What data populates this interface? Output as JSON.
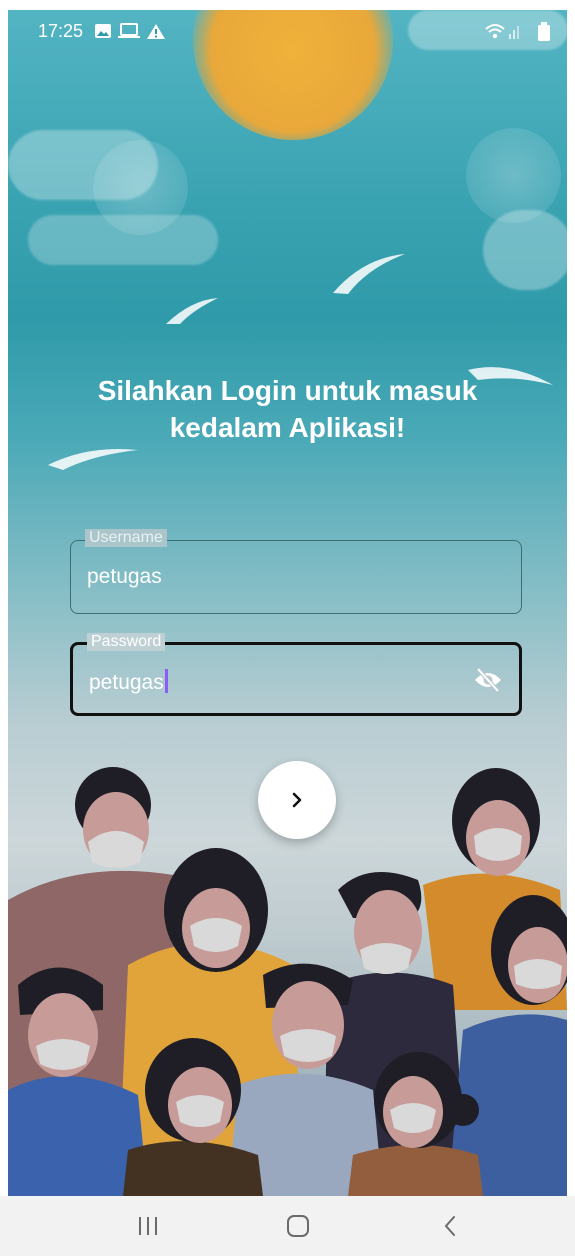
{
  "status_bar": {
    "time": "17:25",
    "icons": [
      "image-icon",
      "laptop-icon",
      "warning-icon",
      "wifi-icon",
      "signal-icon",
      "battery-icon"
    ]
  },
  "login": {
    "heading": "Silahkan Login untuk masuk kedalam Aplikasi!",
    "username": {
      "label": "Username",
      "value": "petugas"
    },
    "password": {
      "label": "Password",
      "value": "petugas",
      "toggle_icon": "eye-off-icon"
    },
    "submit_icon": "chevron-right-icon"
  },
  "nav_bar": {
    "icons": [
      "recent-apps-icon",
      "home-icon",
      "back-icon"
    ]
  },
  "colors": {
    "sky_top": "#53b4c2",
    "sun": "#e9a83a",
    "text": "#ffffff",
    "active_border": "#111111",
    "caret": "#8b5cf6"
  }
}
